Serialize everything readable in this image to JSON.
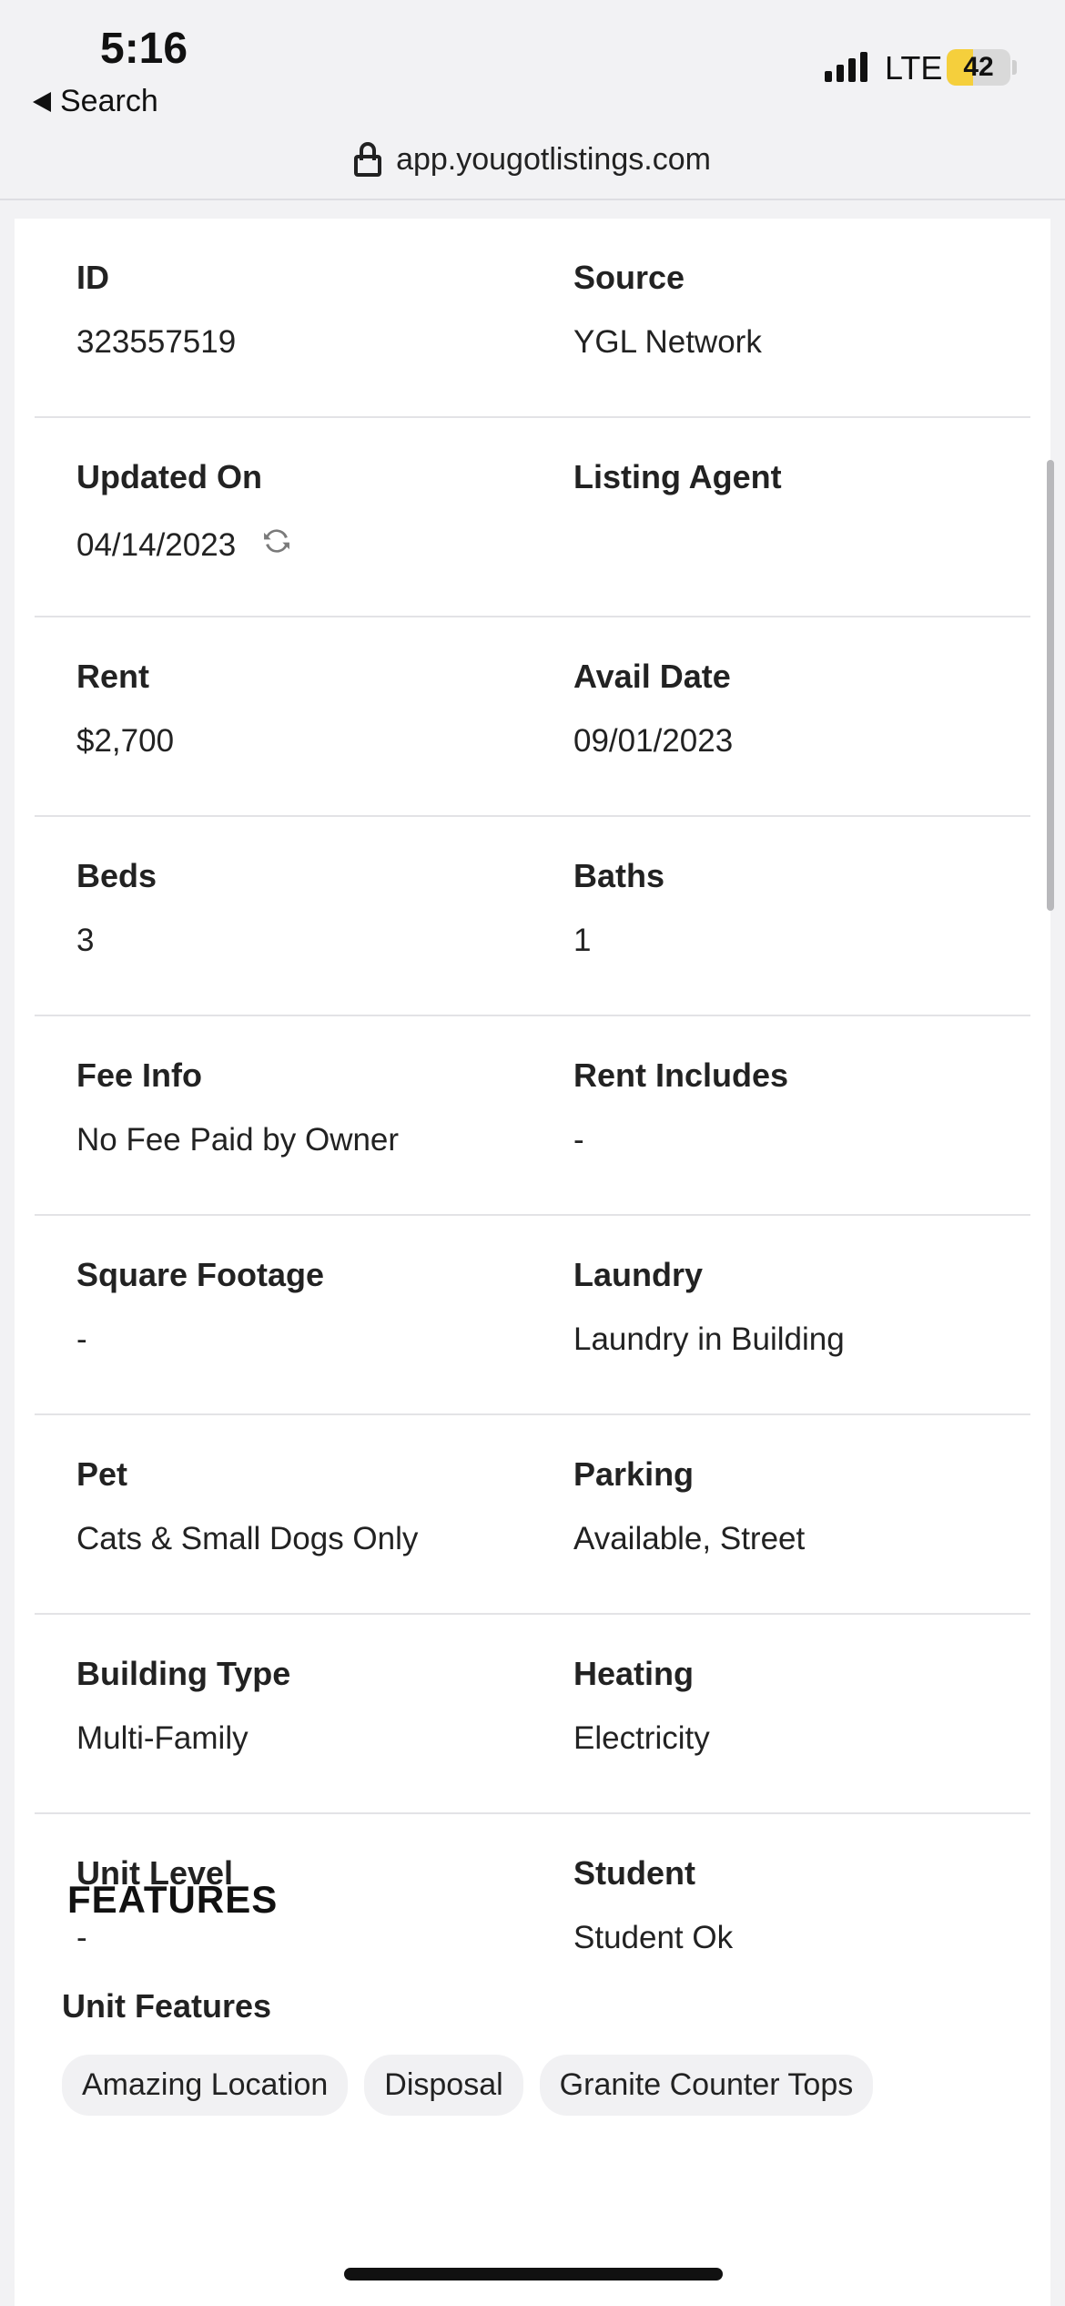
{
  "status": {
    "time": "5:16",
    "back_label": "Search",
    "network": "LTE",
    "battery": "42",
    "battery_level": 0.42
  },
  "browser": {
    "url": "app.yougotlistings.com"
  },
  "details": [
    [
      {
        "label": "ID",
        "value": "323557519"
      },
      {
        "label": "Source",
        "value": "YGL Network"
      }
    ],
    [
      {
        "label": "Updated On",
        "value": "04/14/2023"
      },
      {
        "label": "Listing Agent",
        "value": ""
      }
    ],
    [
      {
        "label": "Rent",
        "value": "$2,700"
      },
      {
        "label": "Avail Date",
        "value": "09/01/2023"
      }
    ],
    [
      {
        "label": "Beds",
        "value": "3"
      },
      {
        "label": "Baths",
        "value": "1"
      }
    ],
    [
      {
        "label": "Fee Info",
        "value": "No Fee Paid by Owner"
      },
      {
        "label": "Rent Includes",
        "value": "-"
      }
    ],
    [
      {
        "label": "Square Footage",
        "value": "-"
      },
      {
        "label": "Laundry",
        "value": "Laundry in Building"
      }
    ],
    [
      {
        "label": "Pet",
        "value": "Cats & Small Dogs Only"
      },
      {
        "label": "Parking",
        "value": "Available, Street"
      }
    ],
    [
      {
        "label": "Building Type",
        "value": "Multi-Family"
      },
      {
        "label": "Heating",
        "value": "Electricity"
      }
    ],
    [
      {
        "label": "Unit Level",
        "value": "-"
      },
      {
        "label": "Student",
        "value": "Student Ok"
      }
    ]
  ],
  "features": {
    "title": "FEATURES",
    "unit_features_label": "Unit Features",
    "chips": [
      "Amazing Location",
      "Disposal",
      "Granite Counter Tops"
    ]
  }
}
